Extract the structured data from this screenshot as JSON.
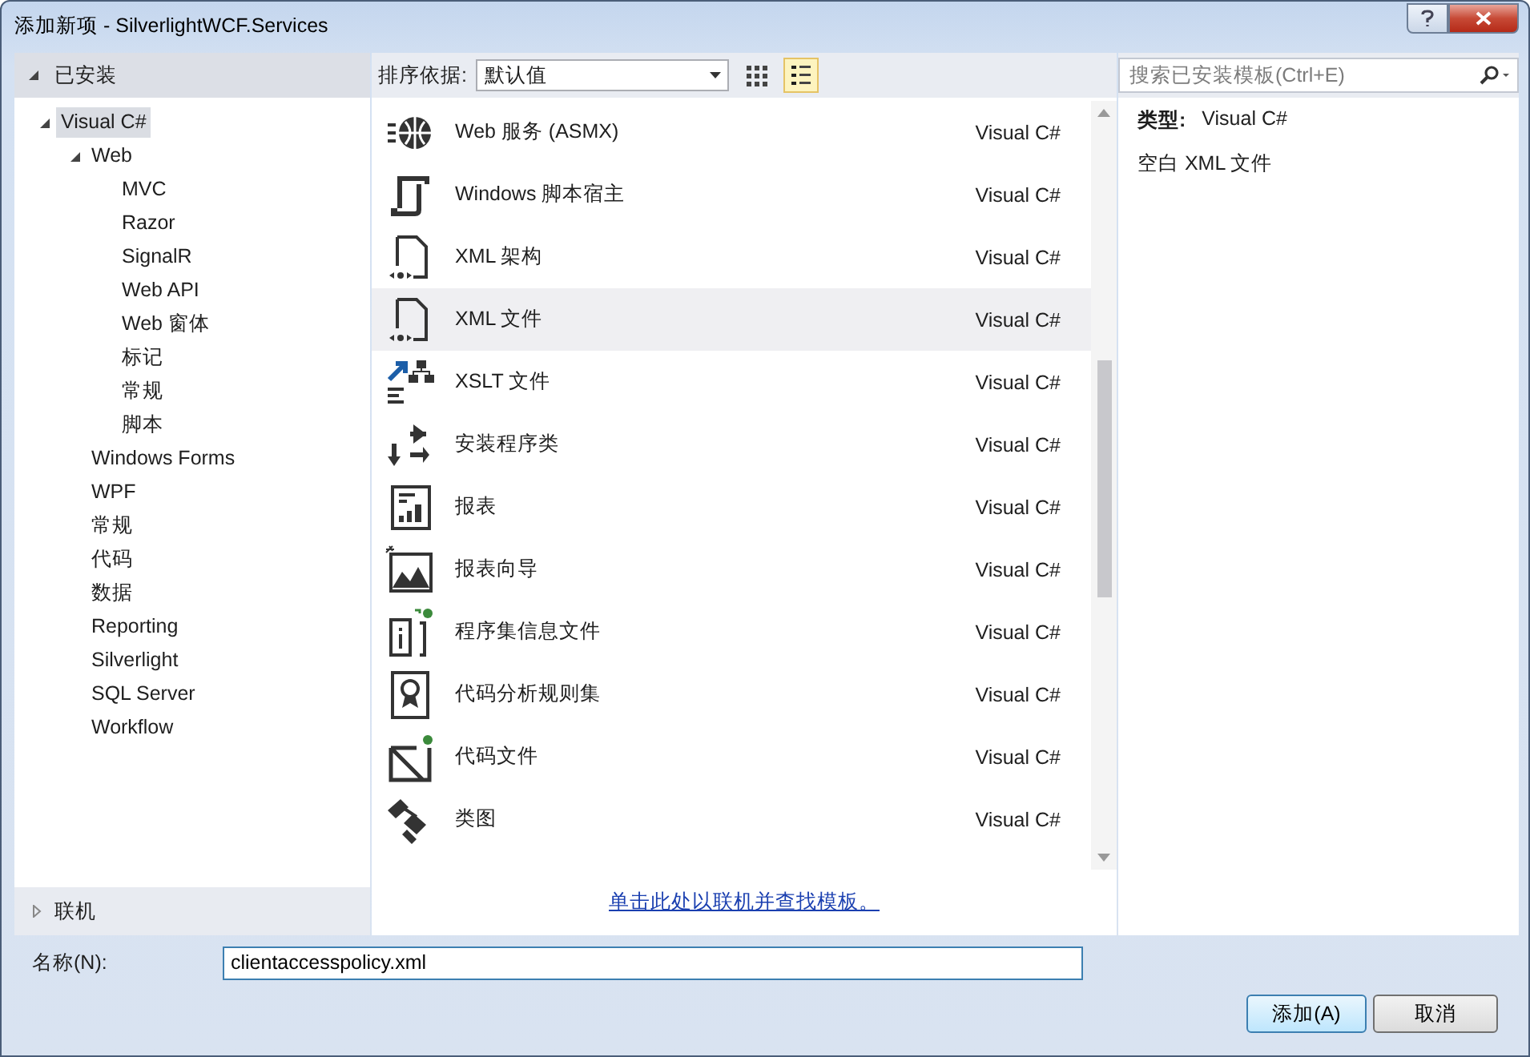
{
  "window": {
    "title": "添加新项 - SilverlightWCF.Services"
  },
  "sidebar": {
    "header": {
      "label": "已安装",
      "expanded": true
    },
    "tree": [
      {
        "label": "Visual C#",
        "selected": true,
        "expanded": true,
        "children": [
          {
            "label": "Web",
            "selected": false,
            "expanded": true,
            "children": [
              {
                "label": "MVC",
                "selected": false
              },
              {
                "label": "Razor",
                "selected": false
              },
              {
                "label": "SignalR",
                "selected": false
              },
              {
                "label": "Web API",
                "selected": false
              },
              {
                "label": "Web 窗体",
                "selected": false
              },
              {
                "label": "标记",
                "selected": false
              },
              {
                "label": "常规",
                "selected": false
              },
              {
                "label": "脚本",
                "selected": false
              }
            ]
          },
          {
            "label": "Windows Forms",
            "selected": false
          },
          {
            "label": "WPF",
            "selected": false
          },
          {
            "label": "常规",
            "selected": false
          },
          {
            "label": "代码",
            "selected": false
          },
          {
            "label": "数据",
            "selected": false
          },
          {
            "label": "Reporting",
            "selected": false
          },
          {
            "label": "Silverlight",
            "selected": false
          },
          {
            "label": "SQL Server",
            "selected": false
          },
          {
            "label": "Workflow",
            "selected": false
          }
        ]
      }
    ],
    "online": {
      "label": "联机",
      "expanded": false
    }
  },
  "toolbar": {
    "sort_label": "排序依据:",
    "sort_value": "默认值",
    "views": [
      {
        "kind": "grid",
        "selected": false
      },
      {
        "kind": "list",
        "selected": true
      }
    ]
  },
  "search": {
    "placeholder": "搜索已安装模板(Ctrl+E)"
  },
  "templates": [
    {
      "kind": "globe",
      "name": "Web 服务 (ASMX)",
      "language": "Visual C#",
      "selected": false
    },
    {
      "kind": "script",
      "name": "Windows 脚本宿主",
      "language": "Visual C#",
      "selected": false
    },
    {
      "kind": "xml",
      "name": "XML 架构",
      "language": "Visual C#",
      "selected": false
    },
    {
      "kind": "xml",
      "name": "XML 文件",
      "language": "Visual C#",
      "selected": true
    },
    {
      "kind": "xslt",
      "name": "XSLT 文件",
      "language": "Visual C#",
      "selected": false
    },
    {
      "kind": "installer",
      "name": "安装程序类",
      "language": "Visual C#",
      "selected": false
    },
    {
      "kind": "report",
      "name": "报表",
      "language": "Visual C#",
      "selected": false
    },
    {
      "kind": "wizard",
      "name": "报表向导",
      "language": "Visual C#",
      "selected": false
    },
    {
      "kind": "info",
      "name": "程序集信息文件",
      "language": "Visual C#",
      "selected": false
    },
    {
      "kind": "ruleset",
      "name": "代码分析规则集",
      "language": "Visual C#",
      "selected": false
    },
    {
      "kind": "code",
      "name": "代码文件",
      "language": "Visual C#",
      "selected": false
    },
    {
      "kind": "diagram",
      "name": "类图",
      "language": "Visual C#",
      "selected": false
    }
  ],
  "online_link": "单击此处以联机并查找模板。",
  "details": {
    "type_label": "类型:",
    "type_value": "Visual C#",
    "description": "空白 XML 文件"
  },
  "name_field": {
    "label": "名称(N):",
    "value": "clientaccesspolicy.xml"
  },
  "buttons": [
    {
      "kind": "primary",
      "label": "添加(A)"
    },
    {
      "kind": "normal",
      "label": "取消"
    }
  ]
}
